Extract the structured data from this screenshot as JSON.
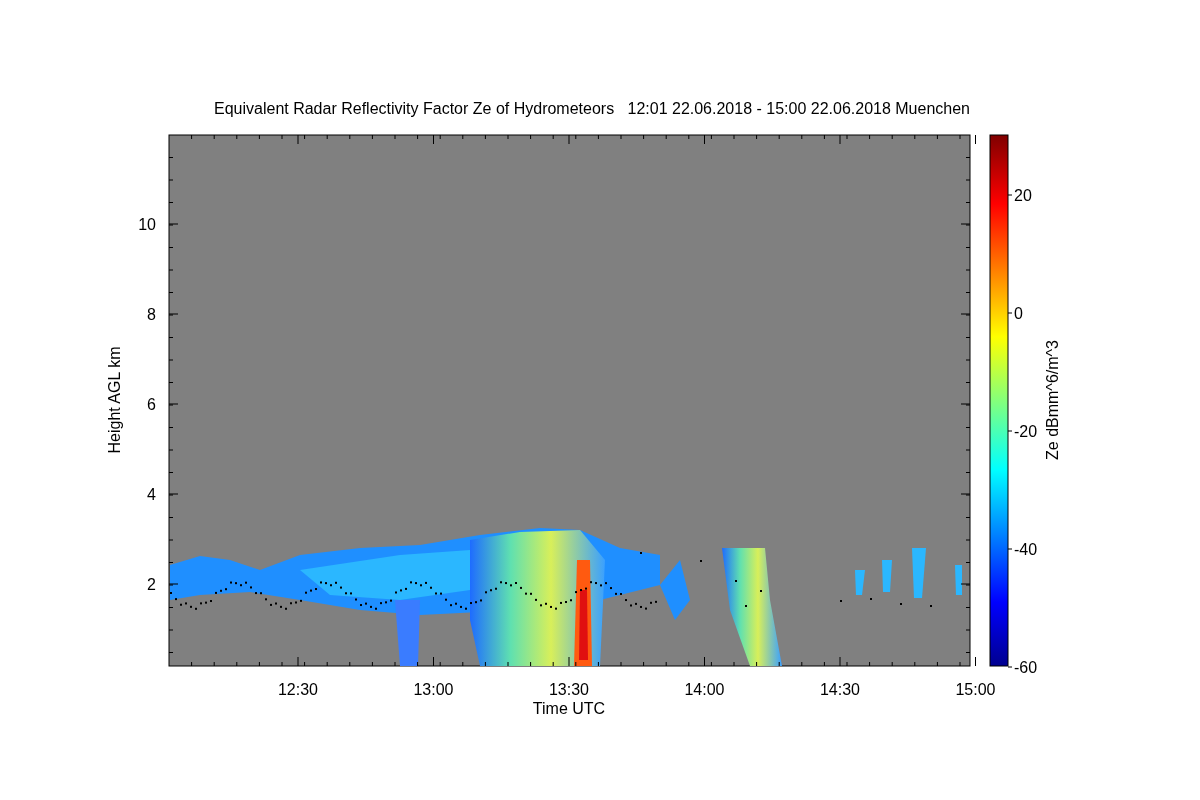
{
  "title": "Equivalent Radar Reflectivity Factor Ze of Hydrometeors   12:01 22.06.2018 - 15:00 22.06.2018 Muenchen",
  "xlabel": "Time UTC",
  "ylabel": "Height AGL km",
  "xticks": [
    "12:30",
    "13:00",
    "13:30",
    "14:00",
    "14:30",
    "15:00"
  ],
  "yticks": [
    "10",
    "8",
    "6",
    "4",
    "2"
  ],
  "colorbar": {
    "label": "Ze dBmm^6/m^3",
    "ticks": [
      "20",
      "0",
      "-20",
      "-40",
      "-60"
    ]
  }
}
